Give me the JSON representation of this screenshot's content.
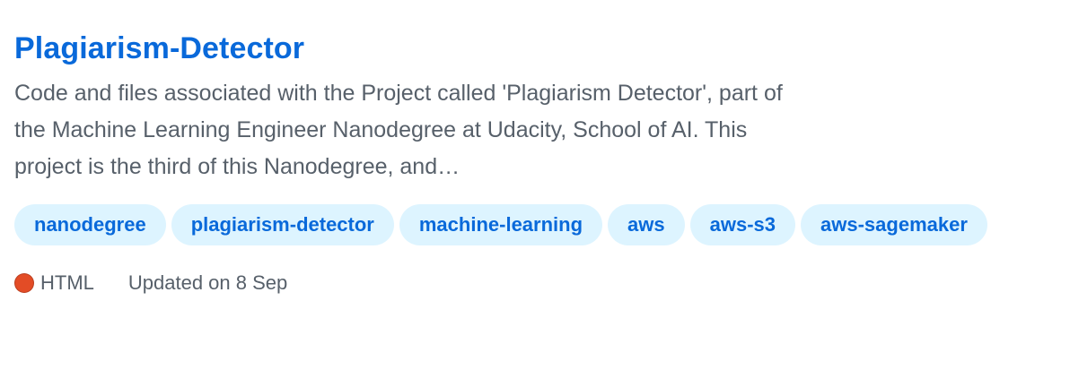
{
  "repo": {
    "name": "Plagiarism-Detector",
    "description": "Code and files associated with the Project called 'Plagiarism Detector', part of the Machine Learning Engineer Nanodegree at Udacity, School of AI. This project is the third of this Nanodegree, and…",
    "topics": [
      "nanodegree",
      "plagiarism-detector",
      "machine-learning",
      "aws",
      "aws-s3",
      "aws-sagemaker"
    ],
    "language": {
      "name": "HTML",
      "color": "#e34c26"
    },
    "updated": "Updated on 8 Sep"
  },
  "colors": {
    "link": "#0969da",
    "topic_bg": "#ddf4ff",
    "muted_text": "#57606a"
  }
}
